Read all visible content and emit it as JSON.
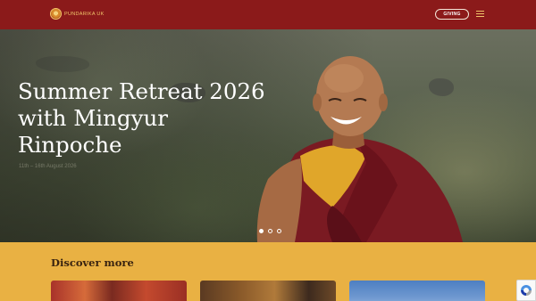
{
  "header": {
    "logo_text": "Pundarika UK",
    "giving_label": "GIVING",
    "menu_icon": "hamburger-menu-icon"
  },
  "hero": {
    "title": "Summer Retreat 2026 with Mingyur Rinpoche",
    "subtitle": "11th – 16th August 2026",
    "slides": 3,
    "active_slide": 1
  },
  "discover": {
    "heading": "Discover more"
  },
  "recaptcha": {
    "icon": "recaptcha-icon"
  },
  "colors": {
    "header_bg": "#8b1a1a",
    "accent_gold": "#e9b143",
    "logo_gold": "#f0c46a"
  }
}
